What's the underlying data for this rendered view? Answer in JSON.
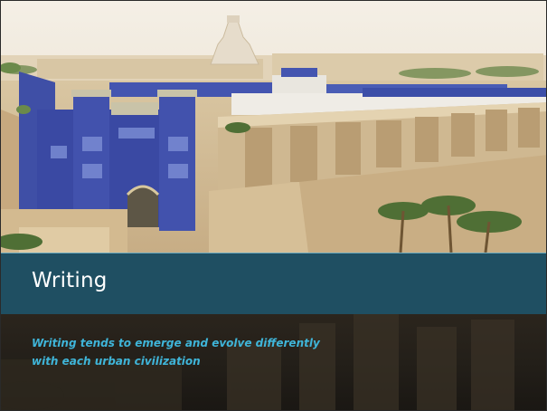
{
  "slide": {
    "title": "Writing",
    "subtitle": "Writing tends to emerge and evolve differently with each urban civilization"
  },
  "image": {
    "subject": "ancient-city-illustration"
  },
  "colors": {
    "title_band": "#1f4f62",
    "subtitle_text": "#3fb5d9",
    "gate_blue": "#3b4aa8",
    "wall_sand": "#cdb58f",
    "background_dark": "#231f19"
  }
}
